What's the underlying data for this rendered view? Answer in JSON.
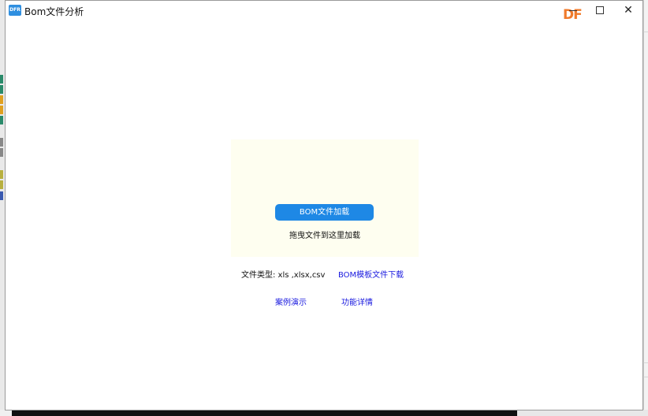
{
  "window": {
    "title": "Bom文件分析",
    "app_icon_text": "DFR",
    "brand_logo": "DF"
  },
  "titlebar_buttons": {
    "minimize_icon": "minimize-icon",
    "maximize_icon": "maximize-icon",
    "close_glyph": "✕"
  },
  "drop_zone": {
    "load_button_label": "BOM文件加载",
    "hint": "拖曳文件到这里加载"
  },
  "file_types": {
    "text": "文件类型:  xls ,xlsx,csv"
  },
  "links": {
    "template_download": "BOM模板文件下载",
    "demo": "案例演示",
    "details": "功能详情"
  },
  "colors": {
    "accent": "#1e88e5",
    "drop_zone_bg": "#fefef0",
    "link": "#1a1adf",
    "brand": "#f07a2a"
  }
}
